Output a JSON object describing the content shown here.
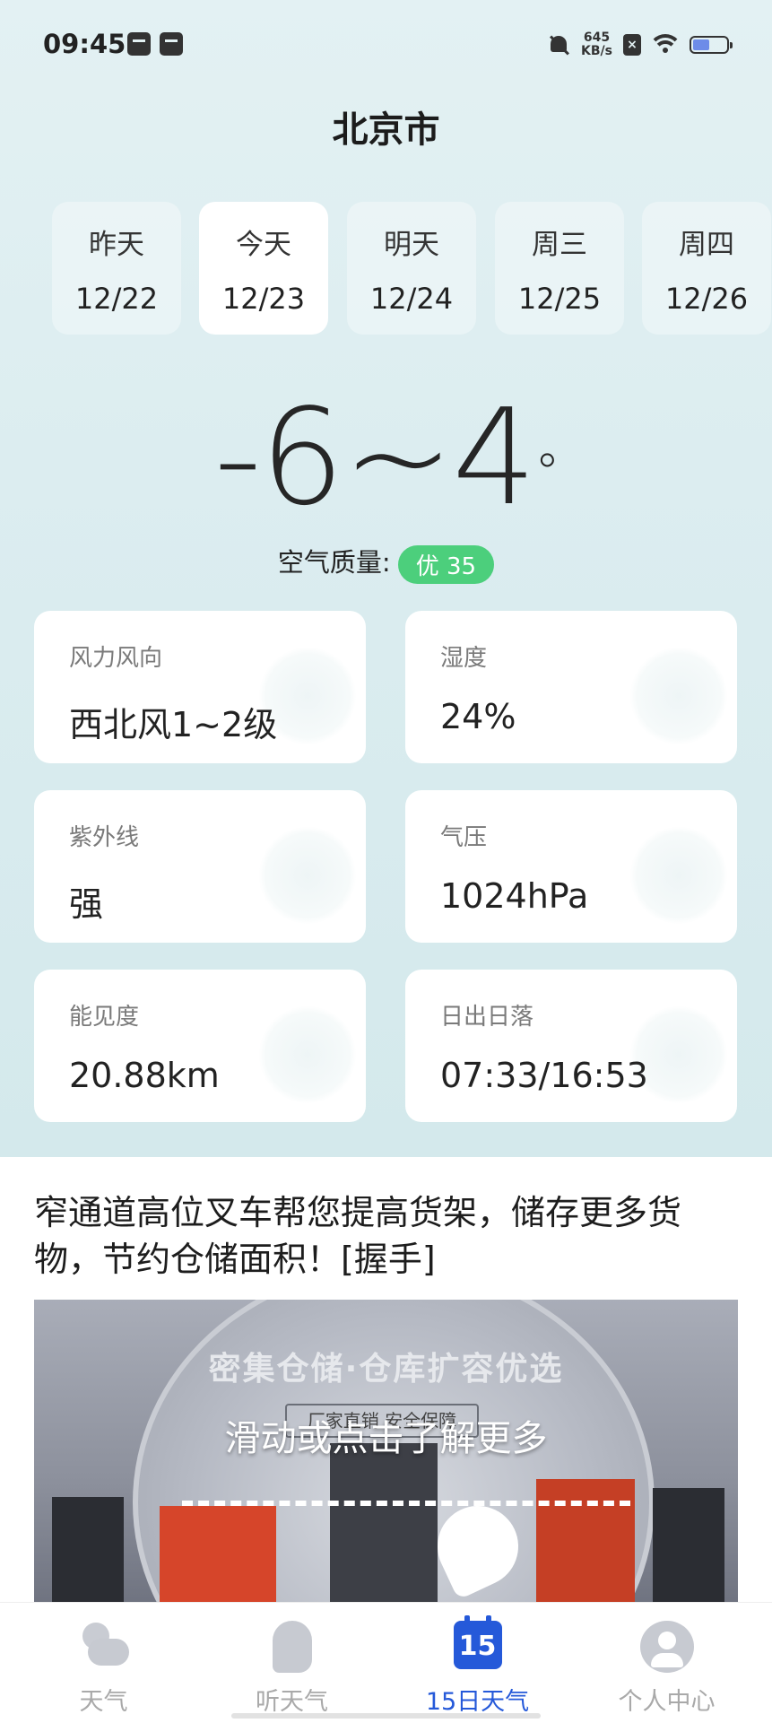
{
  "status_bar": {
    "time": "09:45",
    "net_speed_value": "645",
    "net_speed_unit": "KB/s",
    "battery_level": 0.45
  },
  "city": "北京市",
  "days": [
    {
      "name": "昨天",
      "date": "12/22",
      "active": false
    },
    {
      "name": "今天",
      "date": "12/23",
      "active": true
    },
    {
      "name": "明天",
      "date": "12/24",
      "active": false
    },
    {
      "name": "周三",
      "date": "12/25",
      "active": false
    },
    {
      "name": "周四",
      "date": "12/26",
      "active": false
    }
  ],
  "temperature": {
    "range": "-6~4",
    "unit": "°"
  },
  "air_quality": {
    "label": "空气质量:",
    "badge": "优 35",
    "badge_color": "#4ccf7c"
  },
  "cards": [
    {
      "label": "风力风向",
      "value": "西北风1~2级"
    },
    {
      "label": "湿度",
      "value": "24%"
    },
    {
      "label": "紫外线",
      "value": "强"
    },
    {
      "label": "气压",
      "value": "1024hPa"
    },
    {
      "label": "能见度",
      "value": "20.88km"
    },
    {
      "label": "日出日落",
      "value": "07:33/16:53"
    }
  ],
  "ad": {
    "text": "窄通道高位叉车帮您提高货架，储存更多货物，节约仓储面积！[握手]",
    "image_headline": "密集仓储·仓库扩容优选",
    "image_subline": "厂家直销 安全保障",
    "cta": "滑动或点击了解更多"
  },
  "bottom_nav": {
    "active_color": "#2559d9",
    "items": [
      {
        "label": "天气",
        "icon": "weather-icon",
        "active": false
      },
      {
        "label": "听天气",
        "icon": "ear-icon",
        "active": false
      },
      {
        "label": "15日天气",
        "icon": "calendar-15-icon",
        "icon_text": "15",
        "active": true
      },
      {
        "label": "个人中心",
        "icon": "user-icon",
        "active": false
      }
    ]
  }
}
